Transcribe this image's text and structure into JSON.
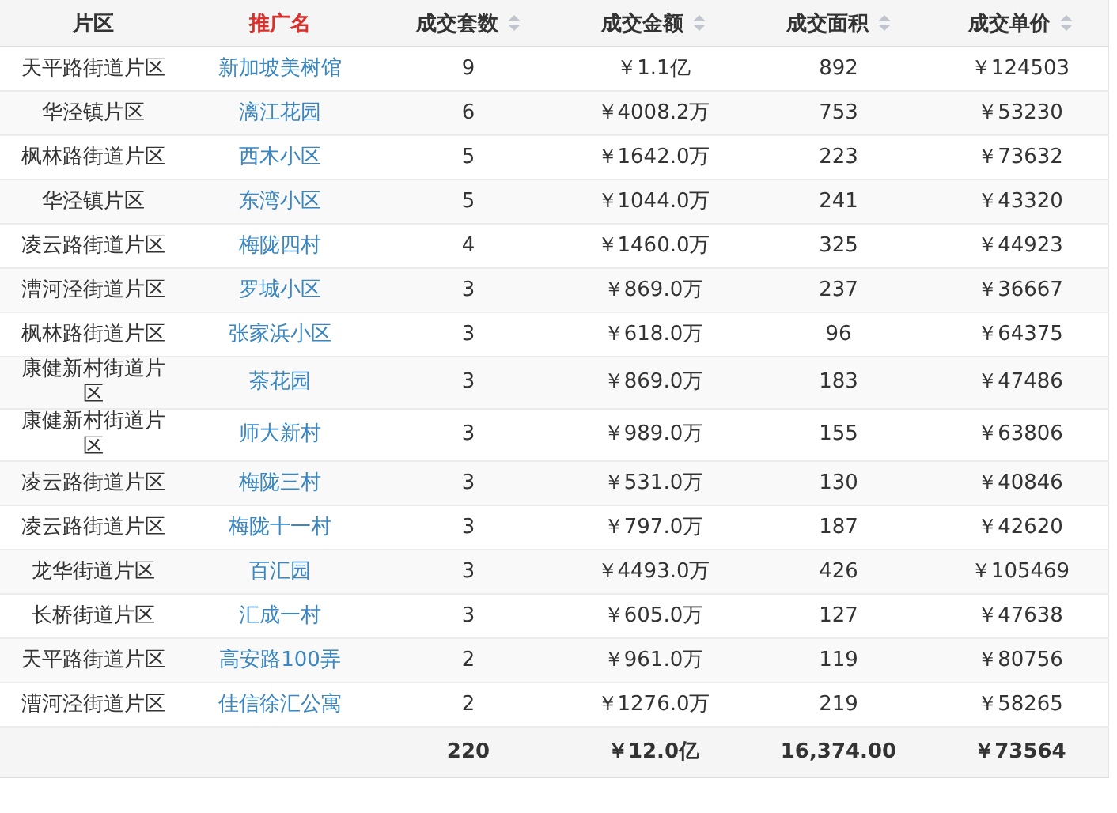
{
  "table": {
    "columns": [
      {
        "label": "片区",
        "sortable": false,
        "selected": false
      },
      {
        "label": "推广名",
        "sortable": false,
        "selected": true
      },
      {
        "label": "成交套数",
        "sortable": true,
        "selected": false
      },
      {
        "label": "成交金额",
        "sortable": true,
        "selected": false
      },
      {
        "label": "成交面积",
        "sortable": true,
        "selected": false
      },
      {
        "label": "成交单价",
        "sortable": true,
        "selected": false
      }
    ],
    "rows": [
      [
        "天平路街道片区",
        "新加坡美树馆",
        "9",
        "￥1.1亿",
        "892",
        "￥124503"
      ],
      [
        "华泾镇片区",
        "漓江花园",
        "6",
        "￥4008.2万",
        "753",
        "￥53230"
      ],
      [
        "枫林路街道片区",
        "西木小区",
        "5",
        "￥1642.0万",
        "223",
        "￥73632"
      ],
      [
        "华泾镇片区",
        "东湾小区",
        "5",
        "￥1044.0万",
        "241",
        "￥43320"
      ],
      [
        "凌云路街道片区",
        "梅陇四村",
        "4",
        "￥1460.0万",
        "325",
        "￥44923"
      ],
      [
        "漕河泾街道片区",
        "罗城小区",
        "3",
        "￥869.0万",
        "237",
        "￥36667"
      ],
      [
        "枫林路街道片区",
        "张家浜小区",
        "3",
        "￥618.0万",
        "96",
        "￥64375"
      ],
      [
        "康健新村街道片区",
        "茶花园",
        "3",
        "￥869.0万",
        "183",
        "￥47486"
      ],
      [
        "康健新村街道片区",
        "师大新村",
        "3",
        "￥989.0万",
        "155",
        "￥63806"
      ],
      [
        "凌云路街道片区",
        "梅陇三村",
        "3",
        "￥531.0万",
        "130",
        "￥40846"
      ],
      [
        "凌云路街道片区",
        "梅陇十一村",
        "3",
        "￥797.0万",
        "187",
        "￥42620"
      ],
      [
        "龙华街道片区",
        "百汇园",
        "3",
        "￥4493.0万",
        "426",
        "￥105469"
      ],
      [
        "长桥街道片区",
        "汇成一村",
        "3",
        "￥605.0万",
        "127",
        "￥47638"
      ],
      [
        "天平路街道片区",
        "高安路100弄",
        "2",
        "￥961.0万",
        "119",
        "￥80756"
      ],
      [
        "漕河泾街道片区",
        "佳信徐汇公寓",
        "2",
        "￥1276.0万",
        "219",
        "￥58265"
      ]
    ],
    "totals": [
      "220",
      "￥12.0亿",
      "16,374.00",
      "￥73564"
    ]
  }
}
